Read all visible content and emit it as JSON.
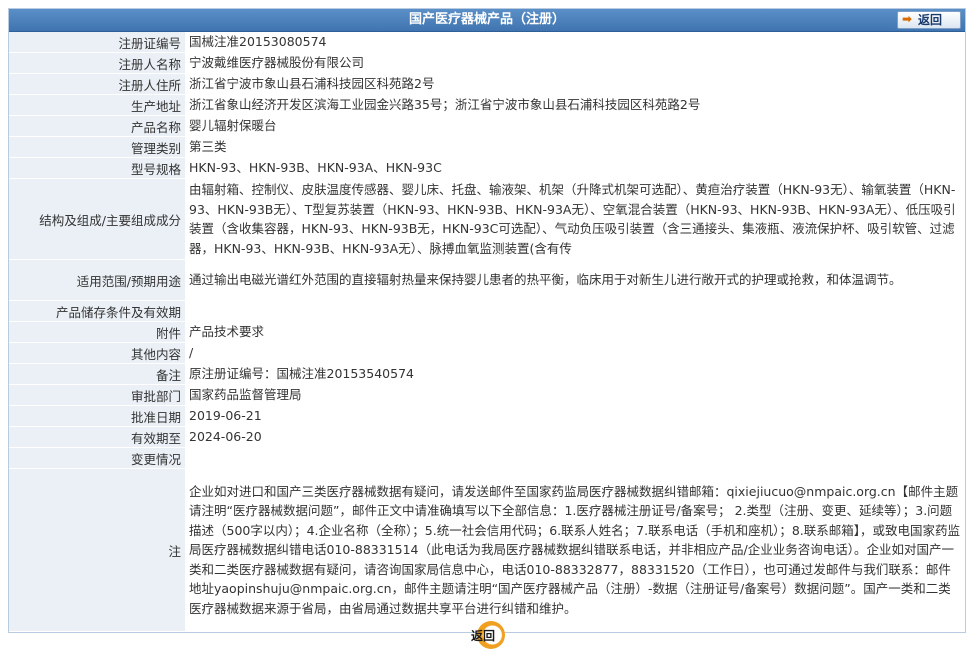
{
  "header": {
    "title": "国产医疗器械产品（注册）",
    "back_label": "返回"
  },
  "rows": [
    {
      "label": "注册证编号",
      "value": "国械注准20153080574"
    },
    {
      "label": "注册人名称",
      "value": "宁波戴维医疗器械股份有限公司"
    },
    {
      "label": "注册人住所",
      "value": "浙江省宁波市象山县石浦科技园区科苑路2号"
    },
    {
      "label": "生产地址",
      "value": "浙江省象山经济开发区滨海工业园金兴路35号；浙江省宁波市象山县石浦科技园区科苑路2号"
    },
    {
      "label": "产品名称",
      "value": "婴儿辐射保暖台"
    },
    {
      "label": "管理类别",
      "value": "第三类"
    },
    {
      "label": "型号规格",
      "value": "HKN-93、HKN-93B、HKN-93A、HKN-93C"
    },
    {
      "label": "结构及组成/主要组成成分",
      "value": "由辐射箱、控制仪、皮肤温度传感器、婴儿床、托盘、输液架、机架（升降式机架可选配）、黄疸治疗装置（HKN-93无）、输氧装置（HKN-93、HKN-93B无）、T型复苏装置（HKN-93、HKN-93B、HKN-93A无）、空氧混合装置（HKN-93、HKN-93B、HKN-93A无）、低压吸引装置（含收集容器，HKN-93、HKN-93B无，HKN-93C可选配）、气动负压吸引装置（含三通接头、集液瓶、液流保护杯、吸引软管、过滤器，HKN-93、HKN-93B、HKN-93A无）、脉搏血氧监测装置(含有传"
    },
    {
      "label": "适用范围/预期用途",
      "value": "通过输出电磁光谱红外范围的直接辐射热量来保持婴儿患者的热平衡，临床用于对新生儿进行敞开式的护理或抢救，和体温调节。"
    },
    {
      "label": "产品储存条件及有效期",
      "value": ""
    },
    {
      "label": "附件",
      "value": "产品技术要求"
    },
    {
      "label": "其他内容",
      "value": "/"
    },
    {
      "label": "备注",
      "value": "原注册证编号：国械注准20153540574"
    },
    {
      "label": "审批部门",
      "value": "国家药品监督管理局"
    },
    {
      "label": "批准日期",
      "value": "2019-06-21"
    },
    {
      "label": "有效期至",
      "value": "2024-06-20"
    },
    {
      "label": "变更情况",
      "value": ""
    },
    {
      "label": "注",
      "value": "企业如对进口和国产三类医疗器械数据有疑问，请发送邮件至国家药监局医疗器械数据纠错邮箱：qixiejiucuo@nmpaic.org.cn【邮件主题请注明“医疗器械数据问题”，邮件正文中请准确填写以下全部信息：1.医疗器械注册证号/备案号； 2.类型（注册、变更、延续等）；3.问题描述（500字以内）；4.企业名称（全称）；5.统一社会信用代码；6.联系人姓名；7.联系电话（手机和座机）；8.联系邮箱】，或致电国家药监局医疗器械数据纠错电话010-88331514（此电话为我局医疗器械数据纠错联系电话，并非相应产品/企业业务咨询电话）。企业如对国产一类和二类医疗器械数据有疑问，请咨询国家局信息中心，电话010-88332877，88331520（工作日），也可通过发邮件与我们联系：邮件地址yaopinshuju@nmpaic.org.cn，邮件主题请注明“国产医疗器械产品（注册）-数据（注册证号/备案号）数据问题”。国产一类和二类医疗器械数据来源于省局，由省局通过数据共享平台进行纠错和维护。"
    }
  ],
  "footer": {
    "back_label": "返回"
  }
}
